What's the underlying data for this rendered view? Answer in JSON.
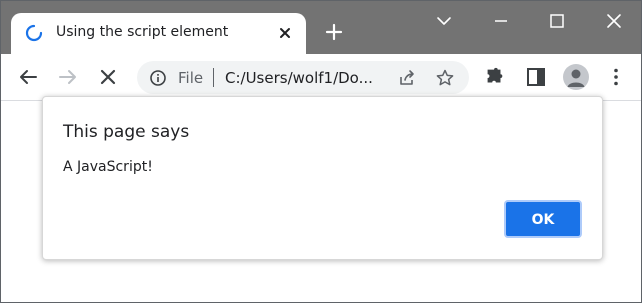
{
  "browser": {
    "tab": {
      "title": "Using the script element",
      "loading": true
    },
    "address_bar": {
      "scheme_label": "File",
      "url": "C:/Users/wolf1/Do..."
    },
    "icons": {
      "tab": [
        "loading-spinner-icon",
        "close-icon"
      ],
      "titlebar": [
        "plus-icon",
        "chevron-down-icon",
        "minimize-icon",
        "maximize-icon",
        "close-icon"
      ],
      "toolbar": [
        "arrow-left-icon",
        "arrow-right-icon",
        "stop-icon",
        "info-icon",
        "share-icon",
        "star-icon",
        "puzzle-icon",
        "side-panel-icon",
        "profile-icon",
        "kebab-menu-icon"
      ]
    }
  },
  "dialog": {
    "title": "This page says",
    "message": "A JavaScript!",
    "ok_label": "OK"
  },
  "colors": {
    "titlebar": "#737373",
    "tab_background": "#ffffff",
    "omnibox_background": "#f1f3f4",
    "accent": "#1a73e8",
    "spinner": "#1a73e8",
    "text": "#202124",
    "icon": "#5f6368"
  }
}
